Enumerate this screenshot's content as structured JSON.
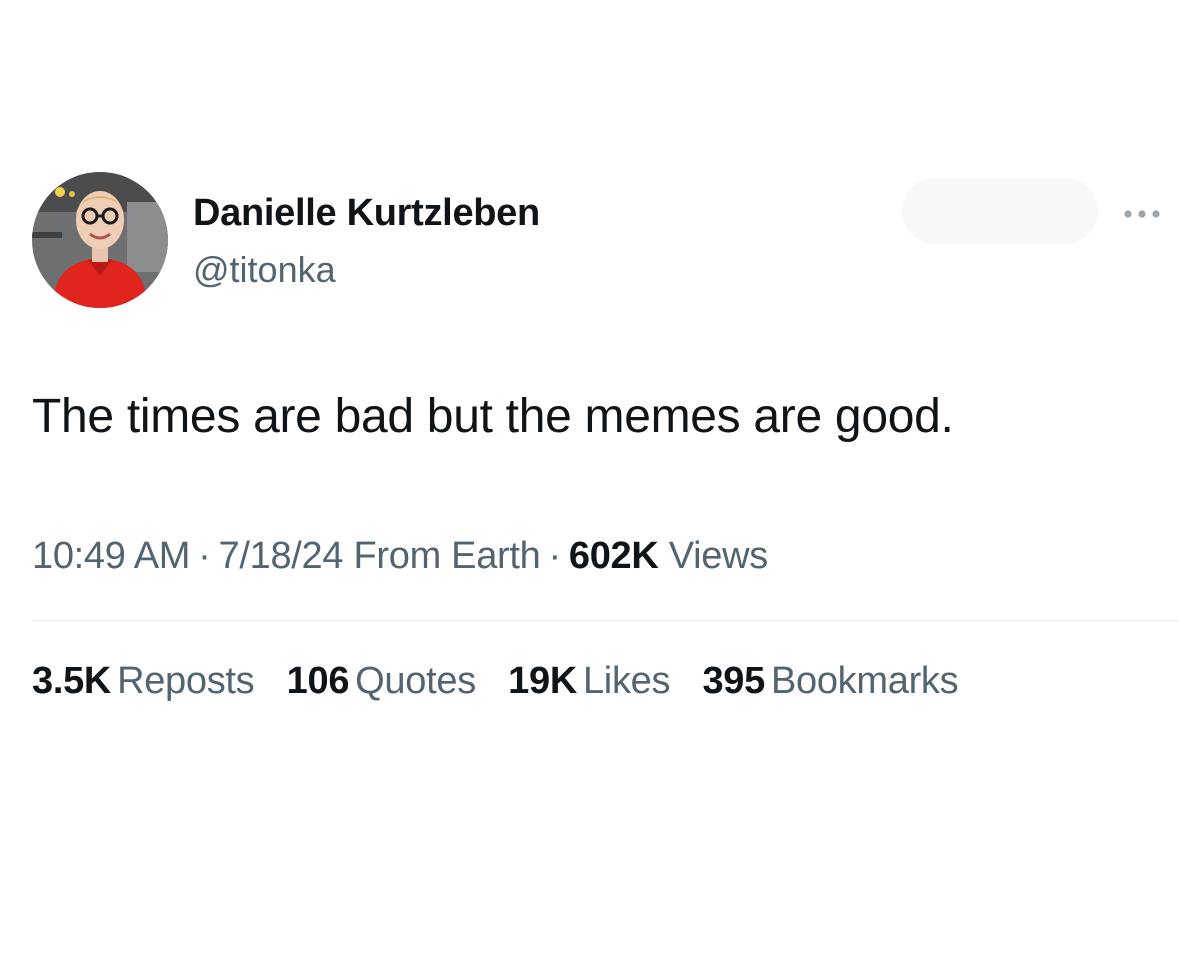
{
  "author": {
    "name": "Danielle Kurtzleben",
    "handle": "@titonka"
  },
  "tweet": {
    "text": "The times are bad but the memes are good."
  },
  "meta": {
    "time": "10:49 AM",
    "date": "7/18/24",
    "source": "From Earth",
    "views_count": "602K",
    "views_label": "Views",
    "separator": "·"
  },
  "stats": [
    {
      "count": "3.5K",
      "label": "Reposts"
    },
    {
      "count": "106",
      "label": "Quotes"
    },
    {
      "count": "19K",
      "label": "Likes"
    },
    {
      "count": "395",
      "label": "Bookmarks"
    }
  ],
  "icons": {
    "more": "more-horizontal-icon"
  },
  "colors": {
    "text_primary": "#0f1419",
    "text_secondary": "#536471",
    "divider": "#e6e9eb",
    "avatar_shirt": "#e0251f"
  }
}
